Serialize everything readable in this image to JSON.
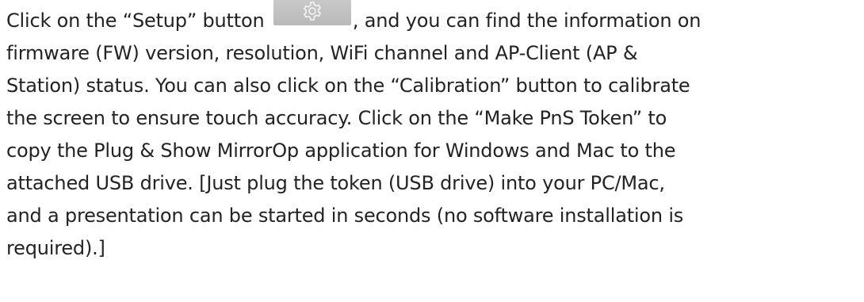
{
  "paragraph": {
    "line1_a": "Click on the “Setup” button",
    "line1_b": ", and you can find the information on",
    "line2": "firmware (FW) version, resolution, WiFi channel and AP-Client (AP &",
    "line3": "Station) status. You can also click on the “Calibration” button to calibrate",
    "line4": "the screen to ensure touch accuracy. Click on the “Make PnS Token” to",
    "line5": "copy the Plug & Show MirrorOp application for Windows and Mac to the",
    "line6": "attached USB drive. [Just plug the token (USB drive) into your PC/Mac,",
    "line7": "and a presentation can be started in seconds (no software installation is",
    "line8": "required).]"
  },
  "setup_button": {
    "icon": "gear-icon"
  }
}
